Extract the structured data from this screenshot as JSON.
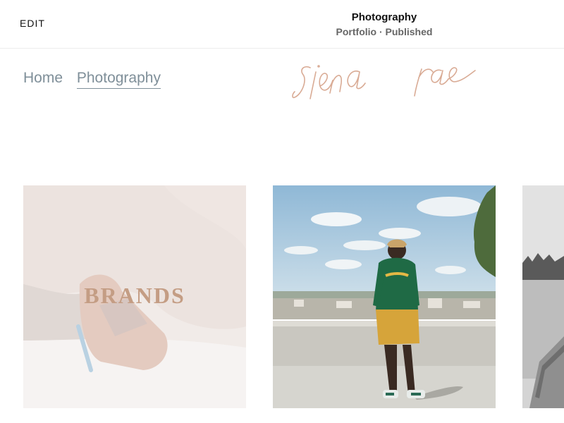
{
  "toolbar": {
    "edit_label": "EDIT",
    "page_title": "Photography",
    "page_status": "Portfolio · Published"
  },
  "site": {
    "logo_text": "siena rae",
    "nav": [
      {
        "label": "Home",
        "active": false
      },
      {
        "label": "Photography",
        "active": true
      }
    ]
  },
  "gallery": {
    "items": [
      {
        "label": "BRANDS",
        "description": "rock and backpack photo"
      },
      {
        "label": "",
        "description": "person in green hoodie on rooftop"
      },
      {
        "label": "",
        "description": "black and white lake photo"
      }
    ]
  },
  "colors": {
    "nav": "#7f8f99",
    "logo": "#d9ab95",
    "brands_label": "#c49d84"
  }
}
